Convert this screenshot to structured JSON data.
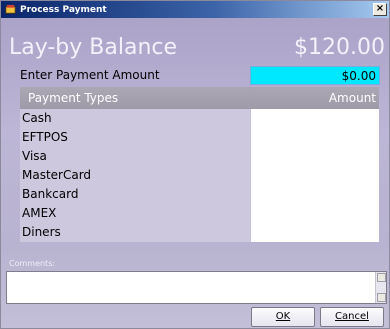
{
  "window": {
    "title": "Process Payment",
    "close_label": "×"
  },
  "balance": {
    "label": "Lay-by Balance",
    "value": "$120.00"
  },
  "payment_entry": {
    "label": "Enter Payment Amount",
    "value": "$0.00"
  },
  "grid": {
    "header_type": "Payment Types",
    "header_amount": "Amount",
    "rows": [
      {
        "type": "Cash",
        "amount": ""
      },
      {
        "type": "EFTPOS",
        "amount": ""
      },
      {
        "type": "Visa",
        "amount": ""
      },
      {
        "type": "MasterCard",
        "amount": ""
      },
      {
        "type": "Bankcard",
        "amount": ""
      },
      {
        "type": "AMEX",
        "amount": ""
      },
      {
        "type": "Diners",
        "amount": ""
      }
    ]
  },
  "comments": {
    "label": "Comments:",
    "value": ""
  },
  "buttons": {
    "ok": "OK",
    "cancel": "Cancel"
  }
}
